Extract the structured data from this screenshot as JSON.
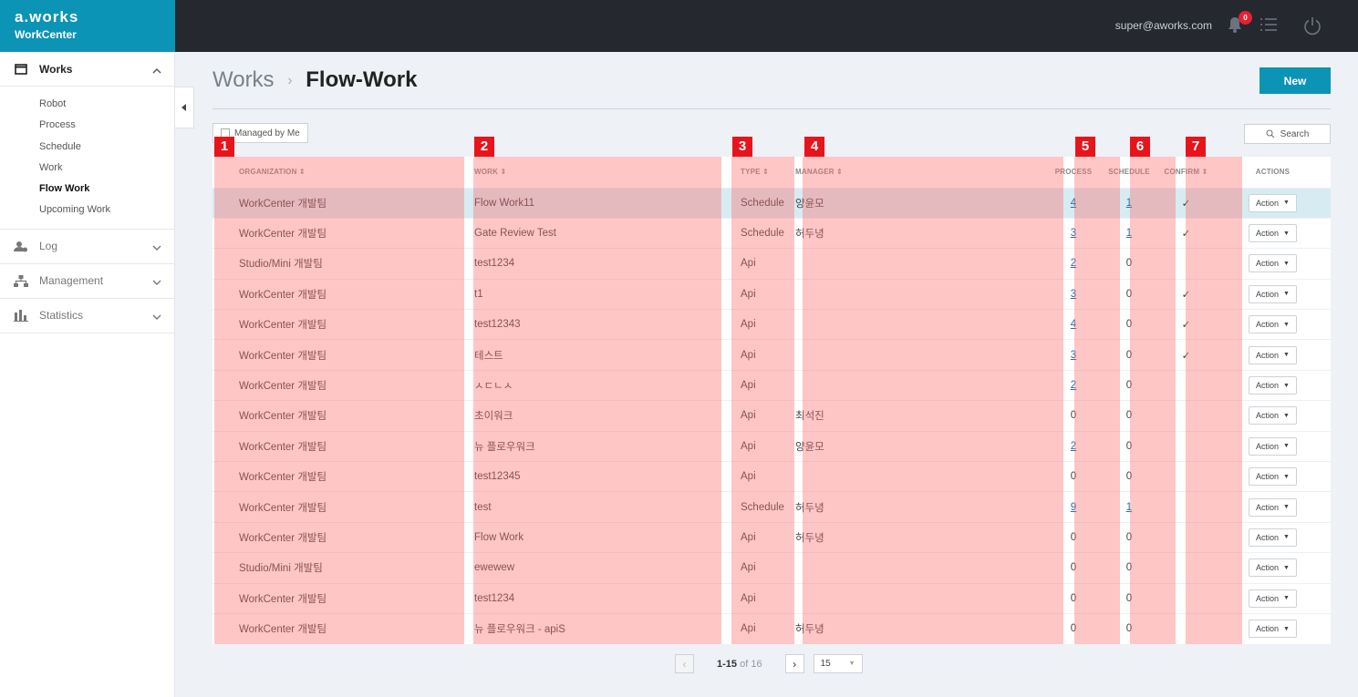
{
  "brand": {
    "logo": "a.works",
    "sub": "WorkCenter"
  },
  "topbar": {
    "user": "super@aworks.com",
    "badge": "0"
  },
  "sidebar": {
    "sections": [
      {
        "label": "Works",
        "icon": "calendar-icon",
        "expanded": true,
        "items": [
          "Robot",
          "Process",
          "Schedule",
          "Work",
          "Flow Work",
          "Upcoming Work"
        ],
        "active_item": "Flow Work"
      },
      {
        "label": "Log",
        "icon": "user-log-icon",
        "expanded": false
      },
      {
        "label": "Management",
        "icon": "org-chart-icon",
        "expanded": false
      },
      {
        "label": "Statistics",
        "icon": "bar-chart-icon",
        "expanded": false
      }
    ]
  },
  "breadcrumb": {
    "parent": "Works",
    "separator": "›",
    "current": "Flow-Work"
  },
  "new_button": "New",
  "filter": {
    "managed_by_me": "Managed by Me",
    "search": "Search"
  },
  "markers": [
    "1",
    "2",
    "3",
    "4",
    "5",
    "6",
    "7"
  ],
  "table": {
    "headers": {
      "organization": "ORGANIZATION ⇕",
      "work": "WORK ⇕",
      "type": "TYPE ⇕",
      "manager": "MANAGER ⇕",
      "process": "PROCESS",
      "schedule": "SCHEDULE",
      "confirm": "CONFIRM ⇕",
      "actions": "ACTIONS"
    },
    "action_label": "Action",
    "rows": [
      {
        "org": "WorkCenter 개발팀",
        "work": "Flow Work11",
        "type": "Schedule",
        "manager": "양윤모",
        "process": "4",
        "process_link": true,
        "schedule": "1",
        "schedule_link": true,
        "confirm": "✓",
        "selected": true
      },
      {
        "org": "WorkCenter 개발팀",
        "work": "Gate Review Test",
        "type": "Schedule",
        "manager": "허두녕",
        "process": "3",
        "process_link": true,
        "schedule": "1",
        "schedule_link": true,
        "confirm": "✓"
      },
      {
        "org": "Studio/Mini 개발팀",
        "work": "test1234",
        "type": "Api",
        "manager": "",
        "process": "2",
        "process_link": true,
        "schedule": "0",
        "confirm": ""
      },
      {
        "org": "WorkCenter 개발팀",
        "work": "t1",
        "type": "Api",
        "manager": "",
        "process": "3",
        "process_link": true,
        "schedule": "0",
        "confirm": "✓"
      },
      {
        "org": "WorkCenter 개발팀",
        "work": "test12343",
        "type": "Api",
        "manager": "",
        "process": "4",
        "process_link": true,
        "schedule": "0",
        "confirm": "✓"
      },
      {
        "org": "WorkCenter 개발팀",
        "work": "테스트",
        "type": "Api",
        "manager": "",
        "process": "3",
        "process_link": true,
        "schedule": "0",
        "confirm": "✓"
      },
      {
        "org": "WorkCenter 개발팀",
        "work": "ㅅㄷㄴㅅ",
        "type": "Api",
        "manager": "",
        "process": "2",
        "process_link": true,
        "schedule": "0",
        "confirm": ""
      },
      {
        "org": "WorkCenter 개발팀",
        "work": "초이워크",
        "type": "Api",
        "manager": "최석진",
        "process": "0",
        "schedule": "0",
        "confirm": ""
      },
      {
        "org": "WorkCenter 개발팀",
        "work": "뉴 플로우워크",
        "type": "Api",
        "manager": "양윤모",
        "process": "2",
        "process_link": true,
        "schedule": "0",
        "confirm": ""
      },
      {
        "org": "WorkCenter 개발팀",
        "work": "test12345",
        "type": "Api",
        "manager": "",
        "process": "0",
        "schedule": "0",
        "confirm": ""
      },
      {
        "org": "WorkCenter 개발팀",
        "work": "test",
        "type": "Schedule",
        "manager": "허두녕",
        "process": "9",
        "process_link": true,
        "schedule": "1",
        "schedule_link": true,
        "confirm": ""
      },
      {
        "org": "WorkCenter 개발팀",
        "work": "Flow Work",
        "type": "Api",
        "manager": "허두녕",
        "process": "0",
        "schedule": "0",
        "confirm": ""
      },
      {
        "org": "Studio/Mini 개발팀",
        "work": "ewewew",
        "type": "Api",
        "manager": "",
        "process": "0",
        "schedule": "0",
        "confirm": ""
      },
      {
        "org": "WorkCenter 개발팀",
        "work": "test1234",
        "type": "Api",
        "manager": "",
        "process": "0",
        "schedule": "0",
        "confirm": ""
      },
      {
        "org": "WorkCenter 개발팀",
        "work": "뉴 플로우워크 - apiS",
        "type": "Api",
        "manager": "허두녕",
        "process": "0",
        "schedule": "0",
        "confirm": ""
      }
    ]
  },
  "pagination": {
    "range": "1-15",
    "of_label": "of 16",
    "page_size": "15"
  },
  "colors": {
    "brand": "#0b94b5",
    "topbar": "#25282f",
    "marker": "#e8141c",
    "highlight": "rgba(255,105,105,0.38)",
    "selected_row": "#d6ecf2"
  }
}
